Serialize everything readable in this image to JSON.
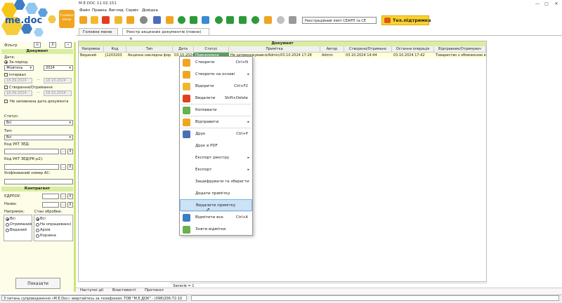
{
  "app": {
    "title": "M.E.DOC 11.02.151",
    "logo_text": "me.doc",
    "home_tile": "Головне меню",
    "window_controls": [
      "—",
      "□",
      "✕"
    ]
  },
  "menu": [
    "Файл",
    "Правка",
    "Вигляд",
    "Сервіс",
    "Довідка"
  ],
  "toolbar": {
    "limit_select": "Реєстраційний ліміт СЕАРП та СЕ",
    "tech_support": "Тех.підтримка"
  },
  "tabs": [
    {
      "label": "Головне меню"
    },
    {
      "label": "Реєстр акцизних документів (повне)",
      "close": "✕"
    }
  ],
  "filter": {
    "title": "Фільтр",
    "btn_x": "X",
    "btn_collapse": "«",
    "section_document": "Документ",
    "date_label": "Дата:",
    "for_period": "За період",
    "month_value": "Жовтень",
    "year_value": "2024",
    "interval": "Інтервал",
    "interval_from": "18.09.2024",
    "interval_to": "18.10.2024",
    "created_label": "Створення/Отримання",
    "created_from": "18.09.2024",
    "created_to": "18.10.2024",
    "no_date": "Не заповнена дата документа",
    "status_label": "Статус:",
    "status_value": "Всі",
    "type_label": "Тип:",
    "type_value": "Всі",
    "ukt_label": "Код УКТ ЗЕД:",
    "ukt2_label": "Код УКТ ЗЕД(РК-р2):",
    "unified_label": "Уніфікований номер АС:",
    "section_counterparty": "Контрагент",
    "edrpou_label": "ЄДРПОУ:",
    "name_label": "Назва:",
    "direction_label": "Напрямок:",
    "direction_options": [
      "Всі",
      "Отриманий",
      "Виданий"
    ],
    "processing_label": "Стан обробки:",
    "processing_options": [
      "Всі",
      "На опрацюванні",
      "Архів",
      "Корзина"
    ],
    "dots": "...",
    "x": "X",
    "show_button": "Показати"
  },
  "grid": {
    "group_title": "Документ",
    "columns": [
      "Напрямок",
      "Код",
      "Тип",
      "Дата",
      "Статус",
      "Примітка",
      "Автор",
      "Створено/Отримано",
      "Остання операція",
      "Відправник/Отримувач"
    ],
    "rows": [
      [
        "Виданий",
        "J1203203",
        "Акцизна накладна фор",
        "03.10.2024",
        "Приналежна",
        "Не затверджувався/Admin/03.10.2024 17:28",
        "Admin",
        "03.10.2024 14:44",
        "03.10.2024 17:42",
        "Товариство з обмеженою в"
      ]
    ],
    "records": "Записів = 1"
  },
  "bottom_tabs": [
    "Наступні дії",
    "Властивості",
    "Протокол"
  ],
  "status_bar": "З питань супроводження «M.E.Doc» звертайтесь за телефоном: ТОВ \"М.Е.ДОК\" - (098)206-72-10",
  "context_menu": [
    {
      "label": "Створити",
      "shortcut": "Ctrl+N",
      "icon": "create-icon",
      "color": "#f0a520"
    },
    {
      "label": "Створити на основі",
      "submenu": "▸",
      "icon": "create-based-icon",
      "color": "#f0a520"
    },
    {
      "label": "Відкрити",
      "shortcut": "Ctrl+F2",
      "icon": "open-icon",
      "color": "#f0b830"
    },
    {
      "label": "Видалити",
      "shortcut": "Shift+Delete",
      "icon": "delete-icon",
      "color": "#e04020"
    },
    {
      "label": "Копіювати",
      "icon": "copy-icon",
      "color": "#6ab04c"
    },
    {
      "label": "Відправити",
      "submenu": "▸",
      "icon": "send-icon",
      "color": "#f0a520"
    },
    {
      "label": "Друк",
      "shortcut": "Ctrl+P",
      "icon": "print-icon",
      "color": "#4a6fb5"
    },
    {
      "label": "Друк в PDF"
    },
    {
      "label": "Експорт реєстру",
      "submenu": "▸"
    },
    {
      "label": "Експорт",
      "submenu": "▸"
    },
    {
      "label": "Зашифрувати та зберегти"
    },
    {
      "label": "Додати примітку"
    },
    {
      "label": "Видалити примітку"
    },
    {
      "label": "Відмітити все",
      "shortcut": "Ctrl+A",
      "icon": "select-all-icon",
      "color": "#3c7dc4"
    },
    {
      "label": "Зняти відмітки",
      "icon": "unselect-icon",
      "color": "#6ab04c"
    }
  ]
}
